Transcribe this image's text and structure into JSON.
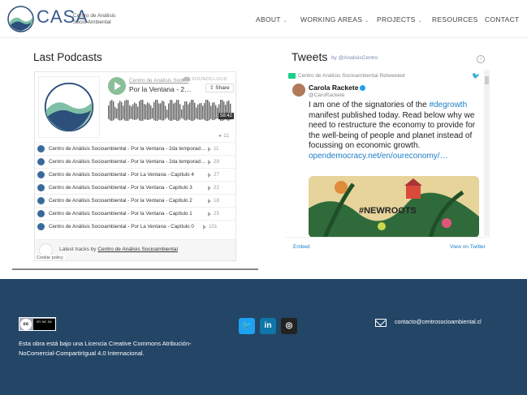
{
  "header": {
    "logo_text": "CASA",
    "logo_sub": "Centro de Análisis Socio Ambiental",
    "nav": [
      {
        "label": "ABOUT",
        "has_dropdown": true
      },
      {
        "label": "WORKING AREAS",
        "has_dropdown": true
      },
      {
        "label": "PROJECTS",
        "has_dropdown": true
      },
      {
        "label": "RESOURCES",
        "has_dropdown": false
      },
      {
        "label": "CONTACT",
        "has_dropdown": false
      }
    ]
  },
  "podcasts": {
    "title": "Last Podcasts",
    "player": {
      "artist": "Centro de Análisis Soci…",
      "track_title": "Por la Ventana - 2…",
      "brand": "SOUNDCLOUD",
      "share_label": "Share",
      "duration": "58:42",
      "plays": "11"
    },
    "tracks": [
      {
        "name": "Centro de Análisis Socioambiental - Por la Ventana - 2da temporad…",
        "count": "11"
      },
      {
        "name": "Centro de Análisis Socioambiental - Por la Ventana - 2da temporad…",
        "count": "29"
      },
      {
        "name": "Centro de Análisis Socioambiental - Por La Ventana - Capítulo 4",
        "count": "27"
      },
      {
        "name": "Centro de Análisis Socioambiental - Por la Ventana - Capítulo 3",
        "count": "22"
      },
      {
        "name": "Centro de Análisis Socioambiental - Por la Ventana - Capítulo 2",
        "count": "18"
      },
      {
        "name": "Centro de Análisis Socioambiental - Por la Ventana - Capítulo 1",
        "count": "25"
      },
      {
        "name": "Centro de Análisis Socioambiental - Por La Ventana - Capítulo 0",
        "count": "101"
      }
    ],
    "footer_prefix": "Latest tracks by",
    "footer_link": "Centro de Análisis Socioambiental",
    "cookie": "Cookie policy"
  },
  "tweets": {
    "title": "Tweets",
    "by": "by @AnalisisCentro",
    "retweet_line": "Centro de Análisis Socioambiental Retweeted",
    "author": "Carola Rackete",
    "handle": "@CaroRackete",
    "text_before": "I am one of the signatories of the ",
    "hashtag": "#degrowth",
    "text_after": " manifest published today. Read below why we need to restructure the economy to provide for the well-being of people and planet instead of focussing on economic growth.",
    "link": "opendemocracy.net/en/oureconomy/…",
    "image_text": "#NEWROOTS",
    "embed": "Embed",
    "view_on": "View on Twitter"
  },
  "footer": {
    "cc_label": "cc",
    "cc_by": "BY  NC  SA",
    "license": "Esta obra está bajo una Licencia Creative Commons Atribución-NoComercial-CompartirIgual 4.0 Internacional.",
    "social": [
      {
        "name": "twitter",
        "glyph": "🐦",
        "color": "#1da1f2"
      },
      {
        "name": "linkedin",
        "glyph": "in",
        "color": "#0e76a8"
      },
      {
        "name": "instagram",
        "glyph": "◎",
        "color": "#222222"
      }
    ],
    "email": "contacto@centrosocioambiental.cl"
  }
}
